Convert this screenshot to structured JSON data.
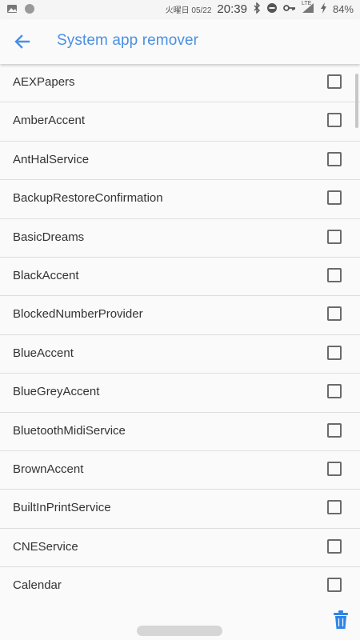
{
  "status_bar": {
    "date": "火曜日 05/22",
    "time": "20:39",
    "battery": "84%",
    "network": "LTE",
    "icons": [
      "image-icon",
      "circle-icon",
      "bluetooth-icon",
      "dnd-icon",
      "key-icon",
      "signal-icon",
      "charging-icon"
    ]
  },
  "app_bar": {
    "title": "System app remover",
    "back_icon": "arrow-back-icon"
  },
  "apps": [
    {
      "name": "AEXPapers",
      "checked": false
    },
    {
      "name": "AmberAccent",
      "checked": false
    },
    {
      "name": "AntHalService",
      "checked": false
    },
    {
      "name": "BackupRestoreConfirmation",
      "checked": false
    },
    {
      "name": "BasicDreams",
      "checked": false
    },
    {
      "name": "BlackAccent",
      "checked": false
    },
    {
      "name": "BlockedNumberProvider",
      "checked": false
    },
    {
      "name": "BlueAccent",
      "checked": false
    },
    {
      "name": "BlueGreyAccent",
      "checked": false
    },
    {
      "name": "BluetoothMidiService",
      "checked": false
    },
    {
      "name": "BrownAccent",
      "checked": false
    },
    {
      "name": "BuiltInPrintService",
      "checked": false
    },
    {
      "name": "CNEService",
      "checked": false
    },
    {
      "name": "Calendar",
      "checked": false
    }
  ],
  "colors": {
    "accent": "#4a90e2",
    "text": "#333333",
    "divider": "#dedede",
    "background": "#fafafa"
  },
  "bottom": {
    "delete_icon": "trash-icon"
  }
}
